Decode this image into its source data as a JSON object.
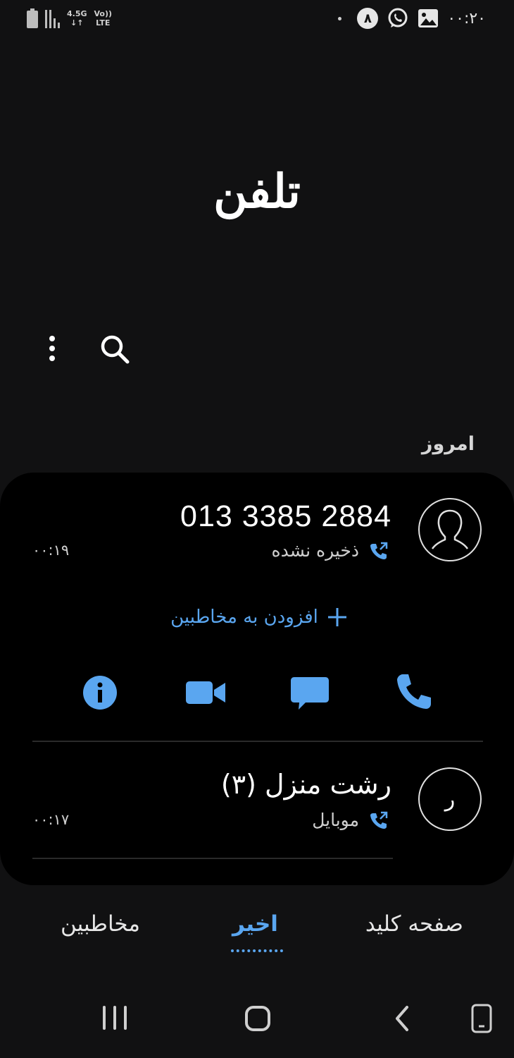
{
  "status_bar": {
    "network_generation": "4.5G",
    "volte": "Vo))",
    "lte": "LTE",
    "notification_badge": "۸",
    "time": "۰۰:۲۰",
    "icons": [
      "battery-icon",
      "signal-icon",
      "dot-icon",
      "whatsapp-icon",
      "image-icon"
    ]
  },
  "app": {
    "title": "تلفن"
  },
  "toolbar": {
    "icons": [
      "more-options-icon",
      "search-icon"
    ]
  },
  "recents": {
    "section_header": "امروز",
    "calls": [
      {
        "number": "013 3385 2884",
        "label": "ذخیره نشده",
        "time": "۰۰:۱۹",
        "avatar_icon": "person-silhouette-icon",
        "direction_icon": "outgoing-call-icon"
      },
      {
        "name": "رشت منزل (۳)",
        "label": "موبایل",
        "time": "۰۰:۱۷",
        "avatar_letter": "ر",
        "direction_icon": "outgoing-call-icon"
      }
    ],
    "add_to_contacts": "افزودن به مخاطبین",
    "actions": [
      "info-icon",
      "video-call-icon",
      "message-icon",
      "voice-call-icon"
    ]
  },
  "tabs": {
    "keypad": "صفحه کلید",
    "recents": "اخیر",
    "contacts": "مخاطبین",
    "selected": "اخیر"
  },
  "colors": {
    "accent": "#5aa6f0",
    "background": "#111112",
    "card": "#000000",
    "text": "#ffffff"
  }
}
